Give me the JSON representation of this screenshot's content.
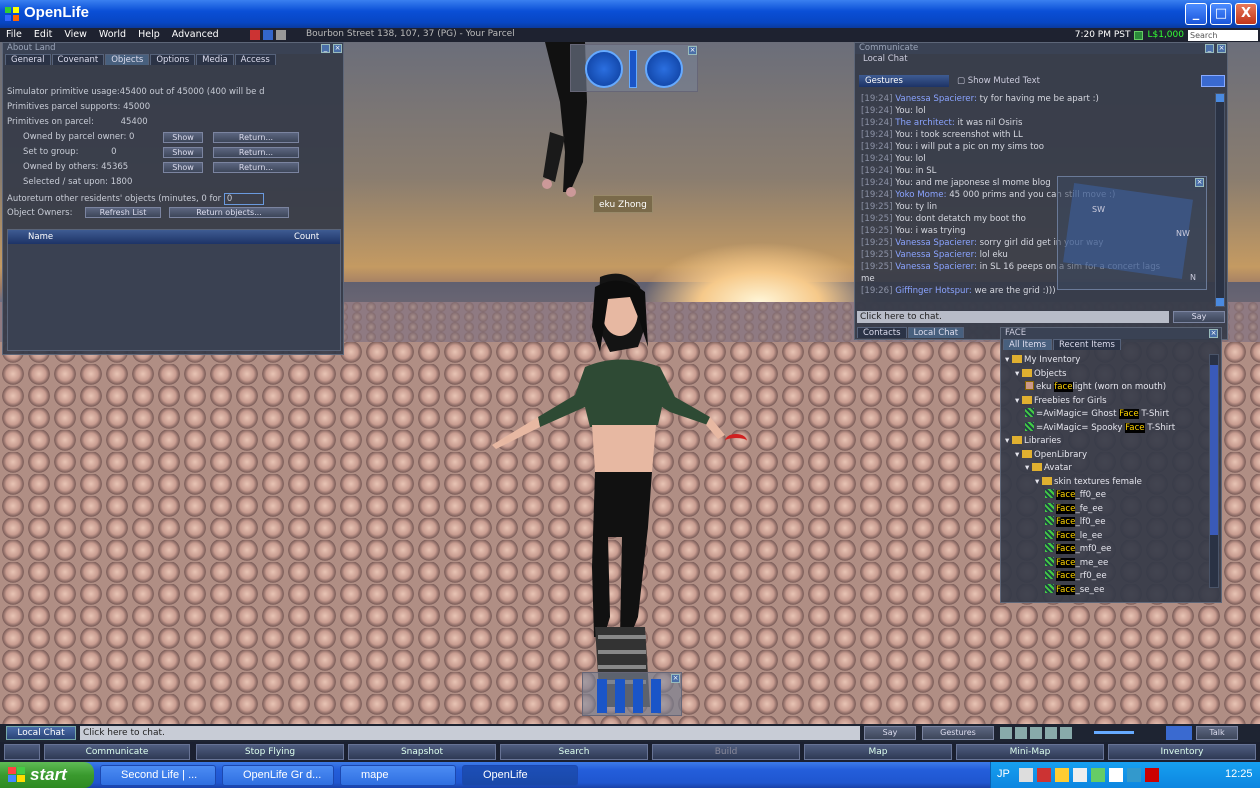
{
  "window": {
    "title": "OpenLife",
    "minimize": "_",
    "maximize": "□",
    "close": "X"
  },
  "menubar": {
    "items": [
      "File",
      "Edit",
      "View",
      "World",
      "Help",
      "Advanced"
    ],
    "location": "Bourbon Street 138, 107, 37 (PG) - Your Parcel",
    "time": "7:20 PM PST",
    "balance": "L$1,000",
    "search_placeholder": "Search"
  },
  "about_land": {
    "title": "About Land",
    "tabs": [
      "General",
      "Covenant",
      "Objects",
      "Options",
      "Media",
      "Access"
    ],
    "simulator_usage": "Simulator primitive usage:45400 out of 45000 (400 will be d",
    "parcel_support_label": "Primitives parcel supports:",
    "parcel_support_value": "45000",
    "on_parcel_label": "Primitives on parcel:",
    "on_parcel_value": "45400",
    "owned_parcel_label": "Owned by parcel owner:",
    "owned_parcel_value": "0",
    "set_group_label": "Set to group:",
    "set_group_value": "0",
    "owned_others_label": "Owned by others:",
    "owned_others_value": "45365",
    "selected_label": "Selected / sat upon:",
    "selected_value": "1800",
    "autoreturn_label": "Autoreturn other residents' objects (minutes, 0 for ",
    "autoreturn_value": "0",
    "object_owners_label": "Object Owners:",
    "refresh_label": "Refresh List",
    "return_label": "Return objects...",
    "show_label": "Show",
    "return_btn": "Return...",
    "col_name": "Name",
    "col_count": "Count"
  },
  "avatar_tag": "eku Zhong",
  "communicate": {
    "title": "Communicate",
    "tab": "Local Chat",
    "gestures": "Gestures",
    "show_muted": "Show Muted Text",
    "lines": [
      {
        "time": "[19:24]",
        "name": "Vanessa Spacierer:",
        "text": "ty for having me be apart :)"
      },
      {
        "time": "[19:24]",
        "name": "",
        "text": "You: lol"
      },
      {
        "time": "[19:24]",
        "name": "The architect:",
        "text": "it was nil Osiris"
      },
      {
        "time": "[19:24]",
        "name": "",
        "text": "You: i took screenshot with LL"
      },
      {
        "time": "[19:24]",
        "name": "",
        "text": "You: i will put a pic on my sims too"
      },
      {
        "time": "[19:24]",
        "name": "",
        "text": "You: lol"
      },
      {
        "time": "[19:24]",
        "name": "",
        "text": "You: in SL"
      },
      {
        "time": "[19:24]",
        "name": "",
        "text": "You: and me japonese sl mome blog"
      },
      {
        "time": "[19:24]",
        "name": "Yoko Mome:",
        "text": "45 000 prims and you can still move :)"
      },
      {
        "time": "[19:25]",
        "name": "",
        "text": "You: ty lin"
      },
      {
        "time": "[19:25]",
        "name": "",
        "text": "You: dont detatch my boot tho"
      },
      {
        "time": "[19:25]",
        "name": "",
        "text": "You: i was trying"
      },
      {
        "time": "[19:25]",
        "name": "Vanessa Spacierer:",
        "text": "sorry girl did get in your way"
      },
      {
        "time": "[19:25]",
        "name": "Vanessa Spacierer:",
        "text": "lol eku"
      },
      {
        "time": "[19:25]",
        "name": "Vanessa Spacierer:",
        "text": "in SL 16 peeps on a sim for a concert lags"
      },
      {
        "time": "",
        "name": "",
        "text": "me"
      },
      {
        "time": "[19:26]",
        "name": "Giffinger Hotspur:",
        "text": "we are the grid :)))"
      }
    ],
    "input_placeholder": "Click here to chat.",
    "say": "Say",
    "contacts": "Contacts",
    "local_chat": "Local Chat"
  },
  "minimap": {
    "sw": "SW",
    "nw": "NW",
    "n": "N"
  },
  "inventory": {
    "title": "FACE",
    "tabs": [
      "All Items",
      "Recent Items"
    ],
    "items": [
      {
        "indent": 0,
        "kind": "folder",
        "pre": "My Inventory",
        "hl": "",
        "post": ""
      },
      {
        "indent": 1,
        "kind": "folder",
        "pre": "Objects",
        "hl": "",
        "post": ""
      },
      {
        "indent": 2,
        "kind": "obj",
        "pre": "eku ",
        "hl": "face",
        "post": "light (worn on mouth)"
      },
      {
        "indent": 1,
        "kind": "folder",
        "pre": "Freebies for Girls",
        "hl": "",
        "post": ""
      },
      {
        "indent": 2,
        "kind": "tex",
        "pre": "=AviMagic= Ghost ",
        "hl": "Face",
        "post": " T-Shirt"
      },
      {
        "indent": 2,
        "kind": "tex",
        "pre": "=AviMagic= Spooky ",
        "hl": "Face",
        "post": " T-Shirt"
      },
      {
        "indent": 0,
        "kind": "folder",
        "pre": "Libraries",
        "hl": "",
        "post": ""
      },
      {
        "indent": 1,
        "kind": "folder",
        "pre": "OpenLibrary",
        "hl": "",
        "post": ""
      },
      {
        "indent": 2,
        "kind": "folder",
        "pre": "Avatar",
        "hl": "",
        "post": ""
      },
      {
        "indent": 3,
        "kind": "folder",
        "pre": "skin textures female",
        "hl": "",
        "post": ""
      },
      {
        "indent": 4,
        "kind": "tex",
        "pre": "",
        "hl": "Face",
        "post": "_ff0_ee"
      },
      {
        "indent": 4,
        "kind": "tex",
        "pre": "",
        "hl": "Face",
        "post": "_fe_ee"
      },
      {
        "indent": 4,
        "kind": "tex",
        "pre": "",
        "hl": "Face",
        "post": "_lf0_ee"
      },
      {
        "indent": 4,
        "kind": "tex",
        "pre": "",
        "hl": "Face",
        "post": "_le_ee"
      },
      {
        "indent": 4,
        "kind": "tex",
        "pre": "",
        "hl": "Face",
        "post": "_mf0_ee"
      },
      {
        "indent": 4,
        "kind": "tex",
        "pre": "",
        "hl": "Face",
        "post": "_me_ee"
      },
      {
        "indent": 4,
        "kind": "tex",
        "pre": "",
        "hl": "Face",
        "post": "_rf0_ee"
      },
      {
        "indent": 4,
        "kind": "tex",
        "pre": "",
        "hl": "Face",
        "post": "_se_ee"
      }
    ]
  },
  "chatbar": {
    "tab": "Local Chat",
    "placeholder": "Click here to chat.",
    "say": "Say",
    "gestures": "Gestures",
    "talk": "Talk"
  },
  "toolbar": {
    "communicate": "Communicate",
    "stop_flying": "Stop Flying",
    "snapshot": "Snapshot",
    "search": "Search",
    "build": "Build",
    "map": "Map",
    "minimap": "Mini-Map",
    "inventory": "Inventory"
  },
  "taskbar": {
    "start": "start",
    "tasks": [
      "Second Life | ...",
      "OpenLife Gr d...",
      "mape",
      "OpenLife"
    ],
    "lang": "JP",
    "clock": "12:25"
  },
  "colors": {
    "title_bar": "#0a4fd6",
    "start_green": "#3a9a2e",
    "chat_name": "#8aa3ff",
    "highlight": "#ffd400"
  }
}
